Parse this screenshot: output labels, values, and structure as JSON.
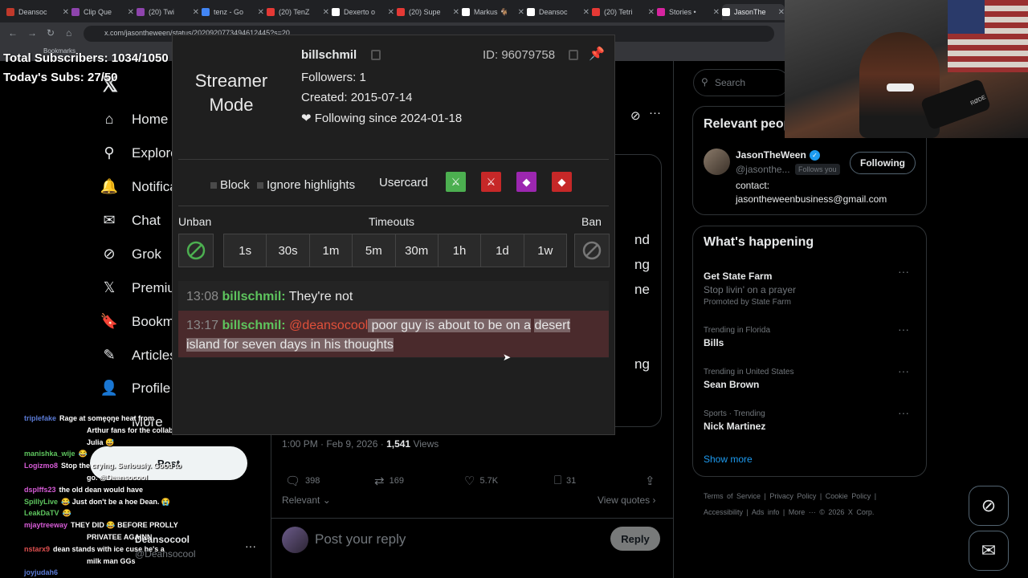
{
  "browser": {
    "tabs": [
      {
        "label": "Deansoc",
        "color": "#c0392b"
      },
      {
        "label": "Clip Que",
        "color": "#8e44ad"
      },
      {
        "label": "(20) Twi",
        "color": "#8e44ad"
      },
      {
        "label": "tenz - Go",
        "color": "#4285f4"
      },
      {
        "label": "(20) TenZ",
        "color": "#e53935"
      },
      {
        "label": "Dexerto o",
        "color": "#ffffff"
      },
      {
        "label": "(20) Supe",
        "color": "#e53935"
      },
      {
        "label": "Markus 🐐",
        "color": "#ffffff"
      },
      {
        "label": "Deansoc",
        "color": "#ffffff"
      },
      {
        "label": "(20) Tetri",
        "color": "#e53935"
      },
      {
        "label": "Stories •",
        "color": "#d6249f"
      },
      {
        "label": "JasonThe",
        "color": "#ffffff"
      }
    ],
    "url": "x.com/jasontheween/status/2020920773494612445?s=20",
    "bookmarks_label": "Bookmarks"
  },
  "overlay": {
    "total_subs": "Total Subscribers: 1034/1050",
    "today_subs": "Today's Subs: 27/50"
  },
  "sidebar": {
    "items": [
      {
        "label": "Home",
        "icon": "home-icon",
        "glyph": "⌂"
      },
      {
        "label": "Explore",
        "icon": "search-icon",
        "glyph": "⚲"
      },
      {
        "label": "Notifications",
        "icon": "bell-icon",
        "glyph": "🔔"
      },
      {
        "label": "Chat",
        "icon": "mail-icon",
        "glyph": "✉"
      },
      {
        "label": "Grok",
        "icon": "grok-icon",
        "glyph": "⊘"
      },
      {
        "label": "Premium",
        "icon": "x-icon",
        "glyph": "𝕏"
      },
      {
        "label": "Bookmarks",
        "icon": "bookmark-icon",
        "glyph": "🔖"
      },
      {
        "label": "Articles",
        "icon": "article-icon",
        "glyph": "✎"
      },
      {
        "label": "Profile",
        "icon": "profile-icon",
        "glyph": "👤"
      },
      {
        "label": "More",
        "icon": "more-icon",
        "glyph": "⋯"
      }
    ],
    "post_button": "Post"
  },
  "tweet": {
    "time": "1:00 PM · Feb 9, 2026 · ",
    "views_count": "1,541",
    "views_label": " Views",
    "replies": "398",
    "reposts": "169",
    "likes": "5.7K",
    "bookmarks": "31",
    "relevant": "Relevant ⌄",
    "view_quotes": "View quotes ›",
    "reply_placeholder": "Post your reply",
    "reply_button": "Reply",
    "ghost_text": [
      "nd",
      "ng",
      "ne",
      "ng"
    ]
  },
  "rightcol": {
    "search_placeholder": "Search",
    "relevant_title": "Relevant people",
    "rel_name": "JasonTheWeen",
    "rel_handle": "@jasonthe...",
    "rel_follows_you": "Follows you",
    "following_button": "Following",
    "rel_bio1": "contact:",
    "rel_bio2": "jasontheweenbusiness@gmail.com",
    "whats_happening": "What's happening",
    "trends": [
      {
        "context": "",
        "name": "Get State Farm",
        "sub": "Stop livin' on a prayer",
        "promo": "Promoted by State Farm"
      },
      {
        "context": "Trending in Florida",
        "name": "Bills",
        "sub": "",
        "promo": ""
      },
      {
        "context": "Trending in United States",
        "name": "Sean Brown",
        "sub": "",
        "promo": ""
      },
      {
        "context": "Sports · Trending",
        "name": "Nick Martinez",
        "sub": "",
        "promo": ""
      }
    ],
    "show_more": "Show more",
    "footer1": "Terms of Service  |  Privacy Policy  |  Cookie Policy  |",
    "footer2": "Accessibility  |  Ads info  |  More ···  © 2026 X Corp."
  },
  "chat_overlay": [
    {
      "user": "triplefake",
      "user_color": "#5b7bd6",
      "text": "Rage at someone heat from"
    },
    {
      "user": "",
      "user_color": "#ffffff",
      "text": "Arthur fans for the collab with"
    },
    {
      "user": "",
      "user_color": "#ffffff",
      "text": "Julia 😅"
    },
    {
      "user": "manishka_wije",
      "user_color": "#5ec55e",
      "text": "😂"
    },
    {
      "user": "Logizmo8",
      "user_color": "#d65bd6",
      "text": "Stop the crying. Seriously. Good to"
    },
    {
      "user": "",
      "user_color": "#ffffff",
      "text": "go. @Deansocool"
    },
    {
      "user": "dsplffs23",
      "user_color": "#d65bd6",
      "text": "the old dean would have"
    },
    {
      "user": "SpillyLive",
      "user_color": "#5ec55e",
      "text": "😂 Just don't be a hoe Dean. 😭"
    },
    {
      "user": "LeakDaTV",
      "user_color": "#5ec55e",
      "text": "😂"
    },
    {
      "user": "mjaytreeway",
      "user_color": "#d65bd6",
      "text": "THEY DID 😂 BEFORE PROLLY"
    },
    {
      "user": "",
      "user_color": "#ffffff",
      "text": "PRIVATEE AGAINN"
    },
    {
      "user": "nstarx9",
      "user_color": "#e05050",
      "text": "dean stands with ice cuse he's a"
    },
    {
      "user": "",
      "user_color": "#ffffff",
      "text": "milk man GGs"
    },
    {
      "user": "joyjudah6",
      "user_color": "#5b7bd6",
      "text": ""
    }
  ],
  "account_switcher": {
    "name": "Deansocool",
    "handle": "@Deansocool"
  },
  "usercard": {
    "streamer_mode": "Streamer Mode",
    "username": "billschmil",
    "id": "ID: 96079758",
    "followers": "Followers: 1",
    "created": "Created: 2015-07-14",
    "following_since": "❤ Following since 2024-01-18",
    "block": "Block",
    "ignore_highlights": "Ignore highlights",
    "usercard_label": "Usercard",
    "unban_label": "Unban",
    "timeouts_label": "Timeouts",
    "ban_label": "Ban",
    "timeouts": [
      "1s",
      "30s",
      "1m",
      "5m",
      "30m",
      "1h",
      "1d",
      "1w"
    ],
    "messages": [
      {
        "time": "13:08",
        "user": "billschmil:",
        "mention": "",
        "text": "They're not"
      },
      {
        "time": "13:17",
        "user": "billschmil:",
        "mention": "@deansocool",
        "text": " poor guy is about to be on a",
        "text2": "desert island for seven days in his thoughts"
      }
    ]
  }
}
